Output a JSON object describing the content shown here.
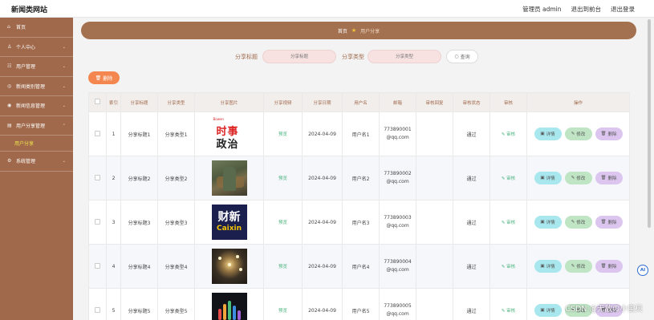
{
  "header": {
    "site_title": "新闻类网站",
    "admin_label": "管理员 admin",
    "back_label": "退出到前台",
    "logout_label": "退出登录"
  },
  "sidebar": {
    "items": [
      {
        "label": "首页",
        "icon": "home-icon"
      },
      {
        "label": "个人中心",
        "icon": "person-icon"
      },
      {
        "label": "用户管理",
        "icon": "users-icon"
      },
      {
        "label": "新闻类别管理",
        "icon": "category-icon"
      },
      {
        "label": "新闻信息管理",
        "icon": "news-icon"
      },
      {
        "label": "用户分享管理",
        "icon": "share-icon"
      },
      {
        "label": "用户分享",
        "sub": true
      },
      {
        "label": "系统管理",
        "icon": "settings-icon"
      }
    ]
  },
  "breadcrumb": {
    "home": "首页",
    "current": "用户分享"
  },
  "search": {
    "title_label": "分享标题",
    "title_placeholder": "分享标题",
    "type_label": "分享类型",
    "type_placeholder": "分享类型",
    "button_label": "查询"
  },
  "actions": {
    "delete_label": "删除"
  },
  "table": {
    "headers": [
      "索引",
      "分享标题",
      "分享类型",
      "分享图片",
      "分享视频",
      "分享日期",
      "用户名",
      "邮箱",
      "审核回复",
      "审核状态",
      "审核",
      "操作"
    ],
    "rows": [
      {
        "index": "1",
        "title": "分享标题1",
        "type": "分享类型1",
        "image_label": "时事政治",
        "video": "预览",
        "date": "2024-04-09",
        "user": "用户名1",
        "email_a": "773890001",
        "email_b": "@qq.com",
        "reply": "",
        "status": "通过",
        "audit": "审核"
      },
      {
        "index": "2",
        "title": "分享标题2",
        "type": "分享类型2",
        "image_label": "",
        "video": "预览",
        "date": "2024-04-09",
        "user": "用户名2",
        "email_a": "773890002",
        "email_b": "@qq.com",
        "reply": "",
        "status": "通过",
        "audit": "审核"
      },
      {
        "index": "3",
        "title": "分享标题3",
        "type": "分享类型3",
        "image_label": "财新 Caixin",
        "video": "预览",
        "date": "2024-04-09",
        "user": "用户名3",
        "email_a": "773890003",
        "email_b": "@qq.com",
        "reply": "",
        "status": "通过",
        "audit": "审核"
      },
      {
        "index": "4",
        "title": "分享标题4",
        "type": "分享类型4",
        "image_label": "",
        "video": "预览",
        "date": "2024-04-09",
        "user": "用户名4",
        "email_a": "773890004",
        "email_b": "@qq.com",
        "reply": "",
        "status": "通过",
        "audit": "审核"
      },
      {
        "index": "5",
        "title": "分享标题5",
        "type": "分享类型5",
        "image_label": "",
        "video": "预览",
        "date": "2024-04-09",
        "user": "用户名5",
        "email_a": "773890005",
        "email_b": "@qq.com",
        "reply": "",
        "status": "通过",
        "audit": "审核"
      }
    ],
    "row_actions": {
      "detail": "详情",
      "edit": "修改",
      "delete": "删除"
    }
  },
  "thumbs": {
    "t1_small": "Bowen",
    "t1_top": "时事",
    "t1_bottom": "政治",
    "t3_top": "财新",
    "t3_bottom": "Caixin"
  },
  "badge": {
    "ai": "AI"
  },
  "watermark": "CSDN @无敌の小宝贝"
}
